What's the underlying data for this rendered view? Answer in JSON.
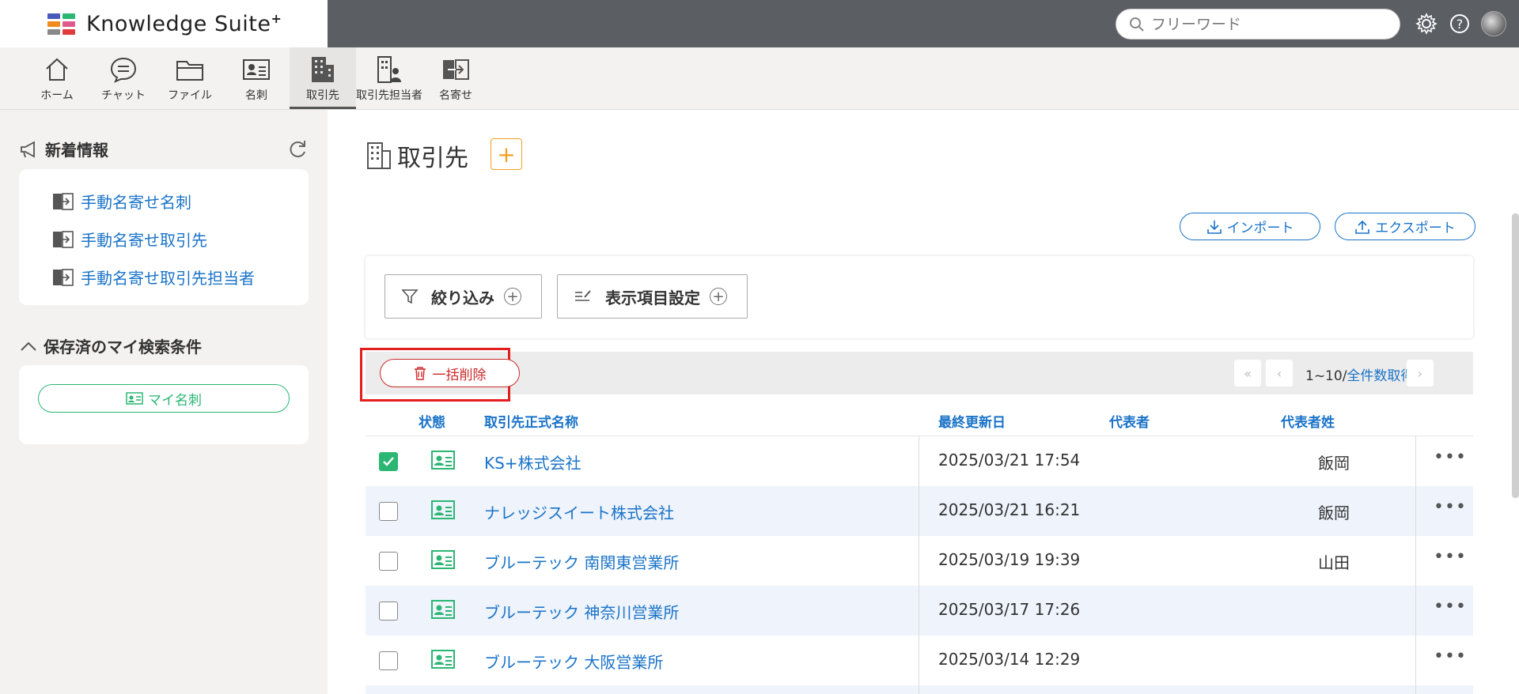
{
  "app": {
    "name": "Knowledge Suite",
    "name_sup": "+",
    "logo_colors": [
      "#4a5ab8",
      "#e05a8c",
      "#f08c1e",
      "#2bb673",
      "#888888",
      "#e23b3b"
    ]
  },
  "header": {
    "search_placeholder": "フリーワード",
    "icons": [
      "gear-icon",
      "help-icon",
      "avatar"
    ]
  },
  "nav": {
    "items": [
      {
        "label": "ホーム",
        "icon": "home-icon"
      },
      {
        "label": "チャット",
        "icon": "chat-icon"
      },
      {
        "label": "ファイル",
        "icon": "folder-icon"
      },
      {
        "label": "名刺",
        "icon": "business-card-icon"
      },
      {
        "label": "取引先",
        "icon": "building-icon",
        "active": true
      },
      {
        "label": "取引先担当者",
        "icon": "building-person-icon"
      },
      {
        "label": "名寄せ",
        "icon": "merge-icon"
      }
    ]
  },
  "sidebar": {
    "news_title": "新着情報",
    "news_links": [
      "手動名寄せ名刺",
      "手動名寄せ取引先",
      "手動名寄せ取引先担当者"
    ],
    "saved_title": "保存済のマイ検索条件",
    "saved_button": "マイ名刺"
  },
  "main": {
    "title": "取引先",
    "add_label": "+",
    "import_label": "インポート",
    "export_label": "エクスポート",
    "filter_label": "絞り込み",
    "columns_label": "表示項目設定",
    "bulk_delete_label": "一括削除",
    "pager_range": "1~10/",
    "pager_total_link": "全件数取得",
    "table": {
      "headers": [
        "状態",
        "取引先正式名称",
        "最終更新日",
        "代表者",
        "代表者姓"
      ],
      "rows": [
        {
          "checked": true,
          "name": "KS+株式会社",
          "updated": "2025/03/21 17:54",
          "rep": "",
          "rep_surname": "飯岡"
        },
        {
          "checked": false,
          "name": "ナレッジスイート株式会社",
          "updated": "2025/03/21 16:21",
          "rep": "",
          "rep_surname": "飯岡"
        },
        {
          "checked": false,
          "name": "ブルーテック 南関東営業所",
          "updated": "2025/03/19 19:39",
          "rep": "",
          "rep_surname": "山田"
        },
        {
          "checked": false,
          "name": "ブルーテック 神奈川営業所",
          "updated": "2025/03/17 17:26",
          "rep": "",
          "rep_surname": ""
        },
        {
          "checked": false,
          "name": "ブルーテック 大阪営業所",
          "updated": "2025/03/14 12:29",
          "rep": "",
          "rep_surname": ""
        }
      ]
    }
  },
  "colors": {
    "link": "#1a73c8",
    "green": "#2bb673",
    "danger": "#cc2a2a",
    "accent": "#f0a020"
  }
}
